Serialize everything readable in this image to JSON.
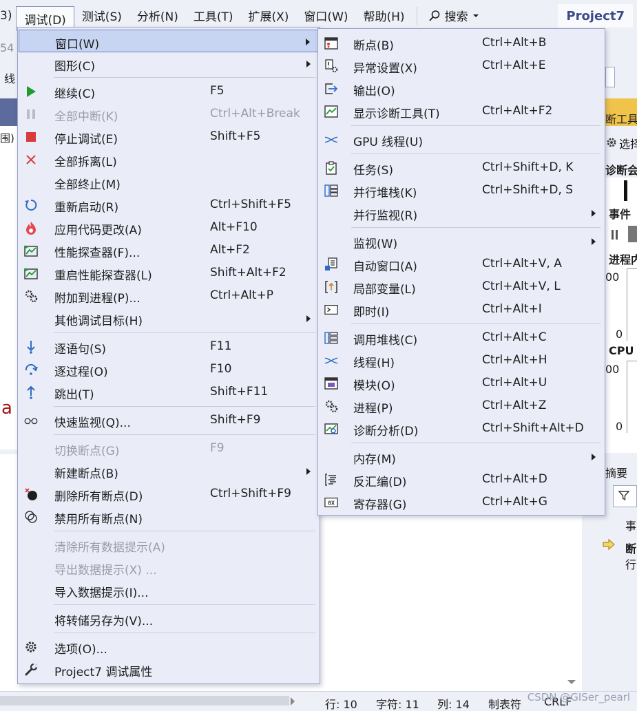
{
  "menubar": {
    "items": [
      {
        "label": "3)"
      },
      {
        "label": "调试(D)"
      },
      {
        "label": "测试(S)"
      },
      {
        "label": "分析(N)"
      },
      {
        "label": "工具(T)"
      },
      {
        "label": "扩展(X)"
      },
      {
        "label": "窗口(W)"
      },
      {
        "label": "帮助(H)"
      }
    ],
    "search_label": "搜索",
    "project": "Project7"
  },
  "background": {
    "left_fragments": [
      "54",
      "线",
      "围)",
      "a"
    ],
    "right_fragments": [
      "断工具",
      "选择",
      "诊断会",
      "事件",
      "进程内",
      "00",
      "0",
      "CPU",
      "00",
      "0",
      "摘要",
      "事",
      "断",
      "行"
    ]
  },
  "statusbar": {
    "line": "行: 10",
    "char": "字符: 11",
    "col": "列: 14",
    "tab": "制表符",
    "eol": "CRLF"
  },
  "watermark": "CSDN @GISer_pearl",
  "debug_menu": {
    "items": [
      {
        "label": "窗口(W)",
        "shortcut": "",
        "submenu": true,
        "icon": "none"
      },
      {
        "label": "图形(C)",
        "shortcut": "",
        "submenu": true,
        "icon": "none"
      },
      {
        "label": "继续(C)",
        "shortcut": "F5",
        "icon": "play-icon"
      },
      {
        "label": "全部中断(K)",
        "shortcut": "Ctrl+Alt+Break",
        "disabled": true,
        "icon": "pause-icon"
      },
      {
        "label": "停止调试(E)",
        "shortcut": "Shift+F5",
        "icon": "stop-icon"
      },
      {
        "label": "全部拆离(L)",
        "shortcut": "",
        "icon": "detach-x-icon"
      },
      {
        "label": "全部终止(M)",
        "shortcut": "",
        "icon": "none"
      },
      {
        "label": "重新启动(R)",
        "shortcut": "Ctrl+Shift+F5",
        "icon": "restart-icon"
      },
      {
        "label": "应用代码更改(A)",
        "shortcut": "Alt+F10",
        "icon": "hot-reload-flame-icon"
      },
      {
        "label": "性能探查器(F)...",
        "shortcut": "Alt+F2",
        "icon": "performance-profiler-icon"
      },
      {
        "label": "重启性能探查器(L)",
        "shortcut": "Shift+Alt+F2",
        "icon": "relaunch-profiler-icon"
      },
      {
        "label": "附加到进程(P)...",
        "shortcut": "Ctrl+Alt+P",
        "icon": "attach-gears-icon"
      },
      {
        "label": "其他调试目标(H)",
        "shortcut": "",
        "submenu": true,
        "icon": "none"
      },
      {
        "label": "逐语句(S)",
        "shortcut": "F11",
        "icon": "step-into-icon"
      },
      {
        "label": "逐过程(O)",
        "shortcut": "F10",
        "icon": "step-over-icon"
      },
      {
        "label": "跳出(T)",
        "shortcut": "Shift+F11",
        "icon": "step-out-icon"
      },
      {
        "label": "快速监视(Q)...",
        "shortcut": "Shift+F9",
        "icon": "glasses-icon"
      },
      {
        "label": "切换断点(G)",
        "shortcut": "F9",
        "disabled": true,
        "icon": "none"
      },
      {
        "label": "新建断点(B)",
        "shortcut": "",
        "submenu": true,
        "icon": "none"
      },
      {
        "label": "删除所有断点(D)",
        "shortcut": "Ctrl+Shift+F9",
        "icon": "delete-breakpoints-icon"
      },
      {
        "label": "禁用所有断点(N)",
        "shortcut": "",
        "icon": "disable-breakpoints-icon"
      },
      {
        "label": "清除所有数据提示(A)",
        "shortcut": "",
        "disabled": true,
        "icon": "none"
      },
      {
        "label": "导出数据提示(X) ...",
        "shortcut": "",
        "disabled": true,
        "icon": "none"
      },
      {
        "label": "导入数据提示(I)...",
        "shortcut": "",
        "icon": "none"
      },
      {
        "label": "将转储另存为(V)...",
        "shortcut": "",
        "icon": "none"
      },
      {
        "label": "选项(O)...",
        "shortcut": "",
        "icon": "settings-gear-icon"
      },
      {
        "label": "Project7 调试属性",
        "shortcut": "",
        "icon": "wrench-icon"
      }
    ]
  },
  "window_menu": {
    "items": [
      {
        "label": "断点(B)",
        "shortcut": "Ctrl+Alt+B",
        "icon": "breakpoints-window-icon"
      },
      {
        "label": "异常设置(X)",
        "shortcut": "Ctrl+Alt+E",
        "icon": "exception-settings-icon"
      },
      {
        "label": "输出(O)",
        "shortcut": "",
        "icon": "output-icon"
      },
      {
        "label": "显示诊断工具(T)",
        "shortcut": "Ctrl+Alt+F2",
        "icon": "diagnostic-tools-icon"
      },
      {
        "label": "GPU 线程(U)",
        "shortcut": "",
        "icon": "gpu-threads-icon"
      },
      {
        "label": "任务(S)",
        "shortcut": "Ctrl+Shift+D, K",
        "icon": "tasks-icon"
      },
      {
        "label": "并行堆栈(K)",
        "shortcut": "Ctrl+Shift+D, S",
        "icon": "parallel-stacks-icon"
      },
      {
        "label": "并行监视(R)",
        "shortcut": "",
        "submenu": true,
        "icon": "none"
      },
      {
        "label": "监视(W)",
        "shortcut": "",
        "submenu": true,
        "icon": "none"
      },
      {
        "label": "自动窗口(A)",
        "shortcut": "Ctrl+Alt+V, A",
        "icon": "autos-icon"
      },
      {
        "label": "局部变量(L)",
        "shortcut": "Ctrl+Alt+V, L",
        "icon": "locals-icon"
      },
      {
        "label": "即时(I)",
        "shortcut": "Ctrl+Alt+I",
        "icon": "immediate-icon"
      },
      {
        "label": "调用堆栈(C)",
        "shortcut": "Ctrl+Alt+C",
        "icon": "call-stack-icon"
      },
      {
        "label": "线程(H)",
        "shortcut": "Ctrl+Alt+H",
        "icon": "threads-icon"
      },
      {
        "label": "模块(O)",
        "shortcut": "Ctrl+Alt+U",
        "icon": "modules-icon"
      },
      {
        "label": "进程(P)",
        "shortcut": "Ctrl+Alt+Z",
        "icon": "processes-icon"
      },
      {
        "label": "诊断分析(D)",
        "shortcut": "Ctrl+Shift+Alt+D",
        "icon": "diagnostic-analysis-icon"
      },
      {
        "label": "内存(M)",
        "shortcut": "",
        "submenu": true,
        "icon": "none"
      },
      {
        "label": "反汇编(D)",
        "shortcut": "Ctrl+Alt+D",
        "icon": "disassembly-icon"
      },
      {
        "label": "寄存器(G)",
        "shortcut": "Ctrl+Alt+G",
        "icon": "registers-icon"
      }
    ]
  },
  "colors": {
    "accent": "#3b4a8a",
    "play_green": "#1e9c2e",
    "stop_red": "#d83b3b",
    "icon_blue": "#2e6bc4",
    "highlight": "#c7d4f2"
  }
}
